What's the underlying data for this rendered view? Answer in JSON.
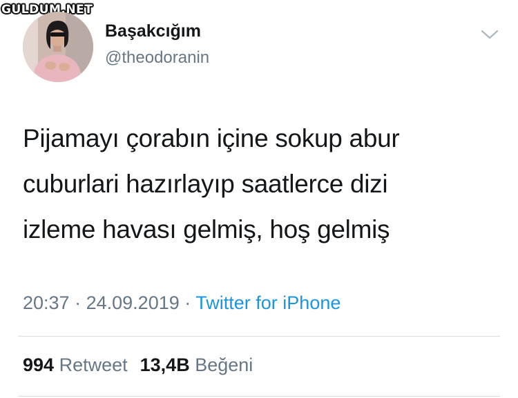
{
  "watermark": "GULDUM.NET",
  "user": {
    "display_name": "Başakcığım",
    "handle": "@theodoranin"
  },
  "tweet": {
    "lines": [
      "Pijamayı çorabın içine sokup abur",
      "cuburlari hazırlayıp saatlerce dizi",
      "izleme havası gelmiş, hoş gelmiş"
    ]
  },
  "meta": {
    "time": "20:37",
    "separator": "·",
    "date": "24.09.2019",
    "source": "Twitter for iPhone"
  },
  "stats": {
    "retweet_count": "994",
    "retweet_label": "Retweet",
    "like_count": "13,4B",
    "like_label": "Beğeni"
  },
  "icons": {
    "menu": "chevron-down-icon"
  },
  "colors": {
    "text": "#14171a",
    "secondary": "#657786",
    "link": "#1b95e0",
    "divider": "#d6dce0"
  }
}
